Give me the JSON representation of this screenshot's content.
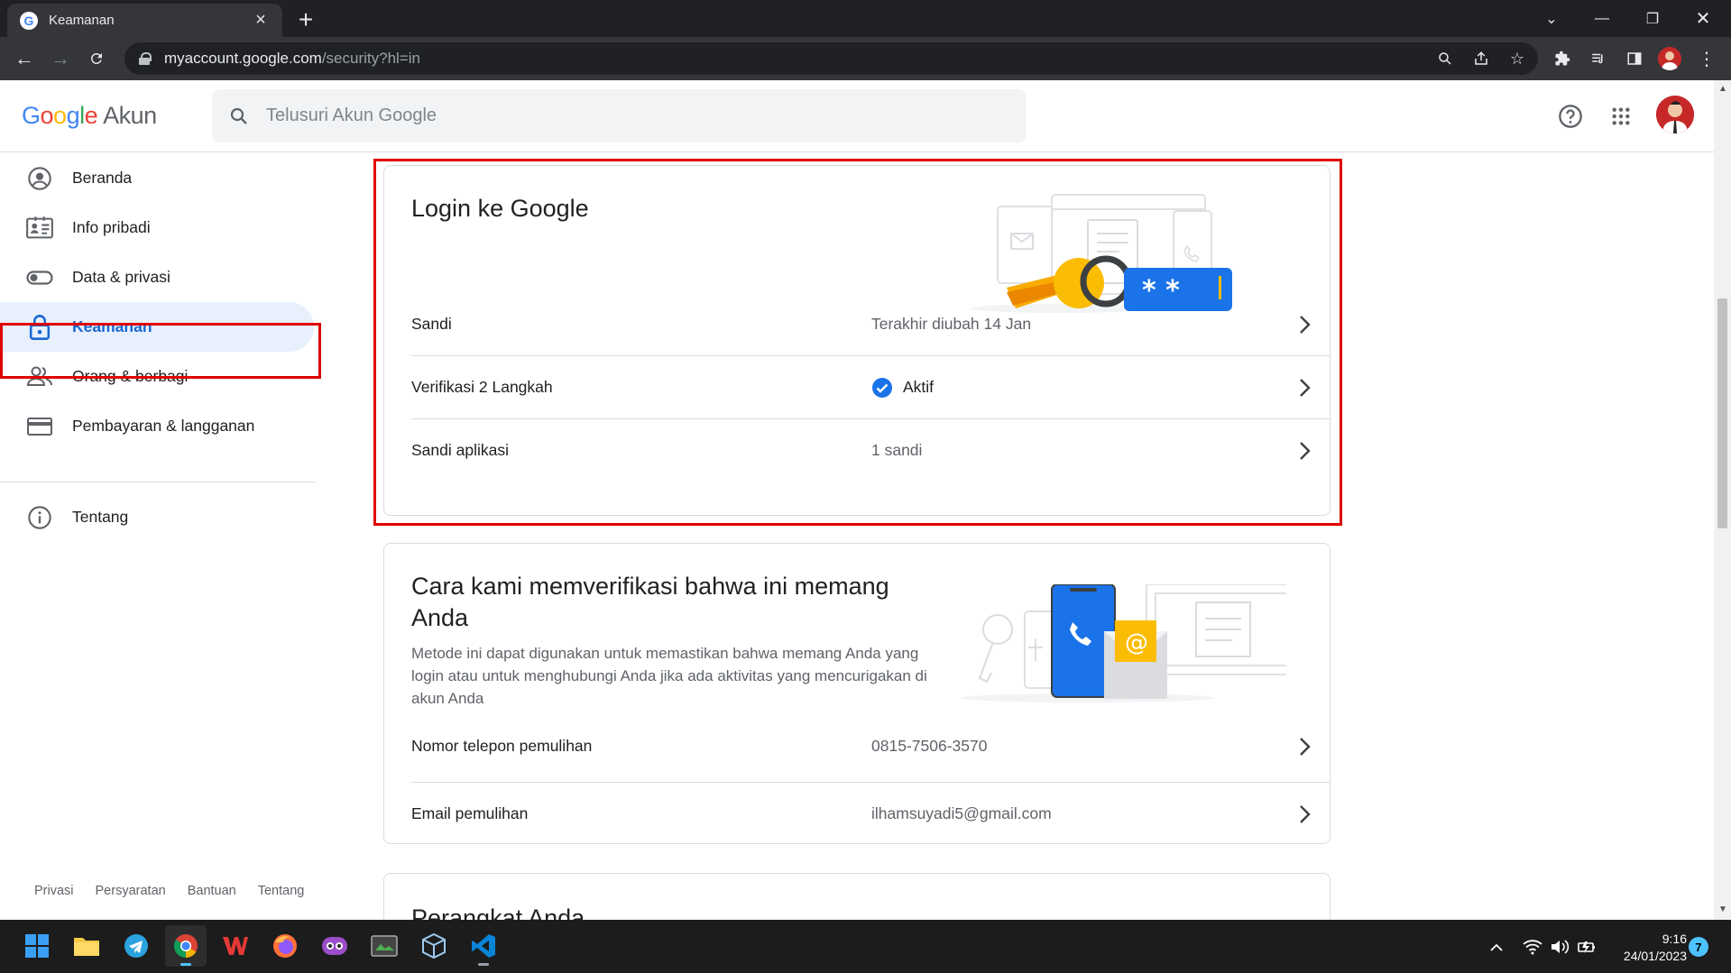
{
  "browser": {
    "tab_title": "Keamanan",
    "url_host": "myaccount.google.com",
    "url_path": "/security?hl=in"
  },
  "header": {
    "logo_google": "Google",
    "logo_suffix": "Akun",
    "search_placeholder": "Telusuri Akun Google"
  },
  "sidebar": {
    "items": [
      {
        "label": "Beranda",
        "icon": "account-circle-icon"
      },
      {
        "label": "Info pribadi",
        "icon": "id-card-icon"
      },
      {
        "label": "Data & privasi",
        "icon": "toggle-icon"
      },
      {
        "label": "Keamanan",
        "icon": "lock-icon",
        "active": true
      },
      {
        "label": "Orang & berbagi",
        "icon": "people-icon"
      },
      {
        "label": "Pembayaran & langganan",
        "icon": "credit-card-icon"
      },
      {
        "label": "Tentang",
        "icon": "info-icon"
      }
    ],
    "footer": [
      "Privasi",
      "Persyaratan",
      "Bantuan",
      "Tentang"
    ]
  },
  "signin_card": {
    "title": "Login ke Google",
    "rows": [
      {
        "label": "Sandi",
        "value": "Terakhir diubah 14 Jan"
      },
      {
        "label": "Verifikasi 2 Langkah",
        "value": "Aktif"
      },
      {
        "label": "Sandi aplikasi",
        "value": "1 sandi"
      }
    ]
  },
  "verify_card": {
    "title": "Cara kami memverifikasi bahwa ini memang Anda",
    "description": "Metode ini dapat digunakan untuk memastikan bahwa memang Anda yang login atau untuk menghubungi Anda jika ada aktivitas yang mencurigakan di akun Anda",
    "rows": [
      {
        "label": "Nomor telepon pemulihan",
        "value": "0815-7506-3570"
      },
      {
        "label": "Email pemulihan",
        "value": "ilhamsuyadi5@gmail.com"
      }
    ]
  },
  "devices_card": {
    "title": "Perangkat Anda"
  },
  "taskbar": {
    "time": "9:16",
    "date": "24/01/2023",
    "notification_count": "7"
  },
  "colors": {
    "accent": "#1a73e8",
    "active_nav_bg": "#e8f0fe",
    "highlight_box": "#e00000"
  }
}
